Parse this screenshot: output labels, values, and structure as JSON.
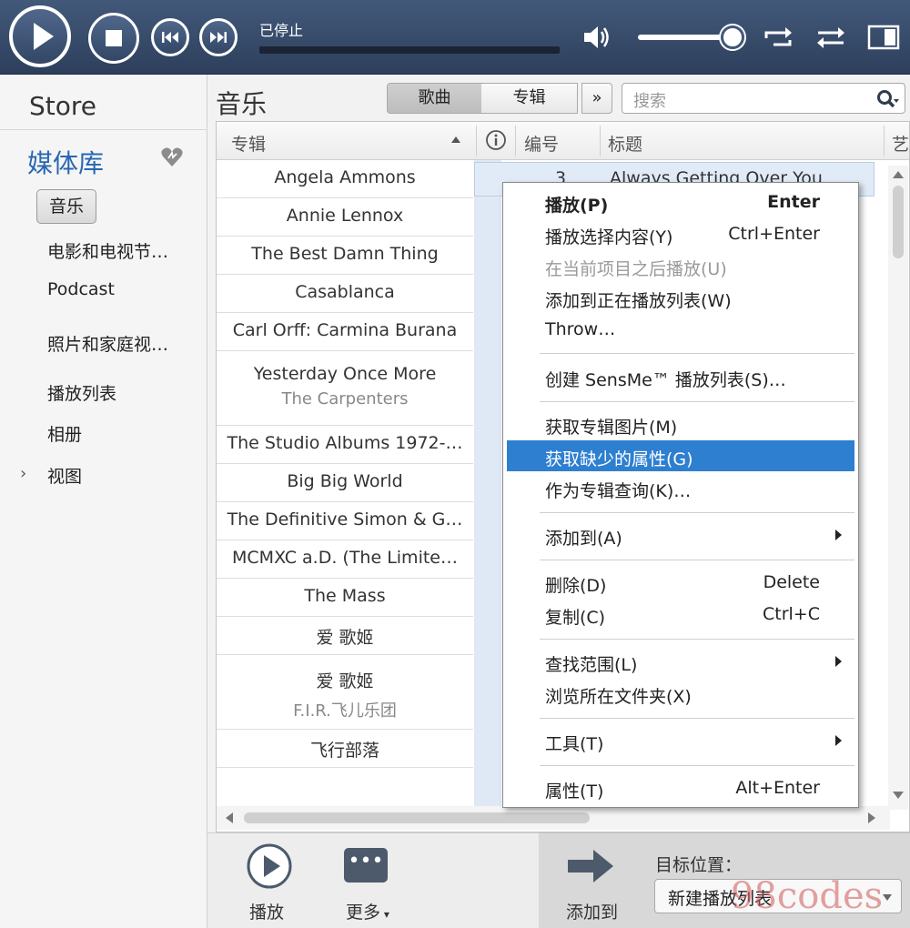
{
  "player": {
    "status": "已停止"
  },
  "sidebar": {
    "store": "Store",
    "library": "媒体库",
    "music": "音乐",
    "items": [
      "电影和电视节…",
      "Podcast",
      "照片和家庭视…",
      "播放列表",
      "相册",
      "视图"
    ]
  },
  "main": {
    "title": "音乐",
    "tabs": [
      "歌曲",
      "专辑"
    ],
    "more": "»",
    "search_placeholder": "搜索"
  },
  "table": {
    "columns": [
      "专辑",
      "编号",
      "标题",
      "艺"
    ],
    "rows": [
      {
        "title": "Angela Ammons"
      },
      {
        "title": "Annie Lennox"
      },
      {
        "title": "The Best Damn Thing"
      },
      {
        "title": "Casablanca"
      },
      {
        "title": "Carl Orff: Carmina Burana"
      },
      {
        "title": "Yesterday Once More",
        "sub": "The Carpenters"
      },
      {
        "title": "The Studio Albums 1972-…"
      },
      {
        "title": "Big Big World"
      },
      {
        "title": "The Definitive Simon & G…"
      },
      {
        "title": "MCMXC a.D. (The Limite…"
      },
      {
        "title": "The Mass"
      },
      {
        "title": "爱 歌姬"
      },
      {
        "title": "爱 歌姬",
        "sub": "F.I.R.飞儿乐团"
      },
      {
        "title": "飞行部落"
      }
    ],
    "selected": {
      "number": "3",
      "title": "Always Getting Over You"
    }
  },
  "context_menu": {
    "items": [
      {
        "label": "播放(P)",
        "shortcut": "Enter",
        "bold": true
      },
      {
        "label": "播放选择内容(Y)",
        "shortcut": "Ctrl+Enter"
      },
      {
        "label": "在当前项目之后播放(U)",
        "disabled": true
      },
      {
        "label": "添加到正在播放列表(W)"
      },
      {
        "label": "Throw…"
      },
      {
        "label": "创建 SensMe™ 播放列表(S)…"
      },
      {
        "label": "获取专辑图片(M)"
      },
      {
        "label": "获取缺少的属性(G)",
        "highlighted": true
      },
      {
        "label": "作为专辑查询(K)…"
      },
      {
        "label": "添加到(A)",
        "submenu": true
      },
      {
        "label": "删除(D)",
        "shortcut": "Delete"
      },
      {
        "label": "复制(C)",
        "shortcut": "Ctrl+C"
      },
      {
        "label": "查找范围(L)",
        "submenu": true
      },
      {
        "label": "浏览所在文件夹(X)"
      },
      {
        "label": "工具(T)",
        "submenu": true
      },
      {
        "label": "属性(T)",
        "shortcut": "Alt+Enter"
      }
    ]
  },
  "bottom": {
    "play": "播放",
    "more": "更多",
    "more_dots": "•••",
    "add_to": "添加到",
    "destination_label": "目标位置：",
    "destination_value": "新建播放列表"
  },
  "watermark": "98codes"
}
